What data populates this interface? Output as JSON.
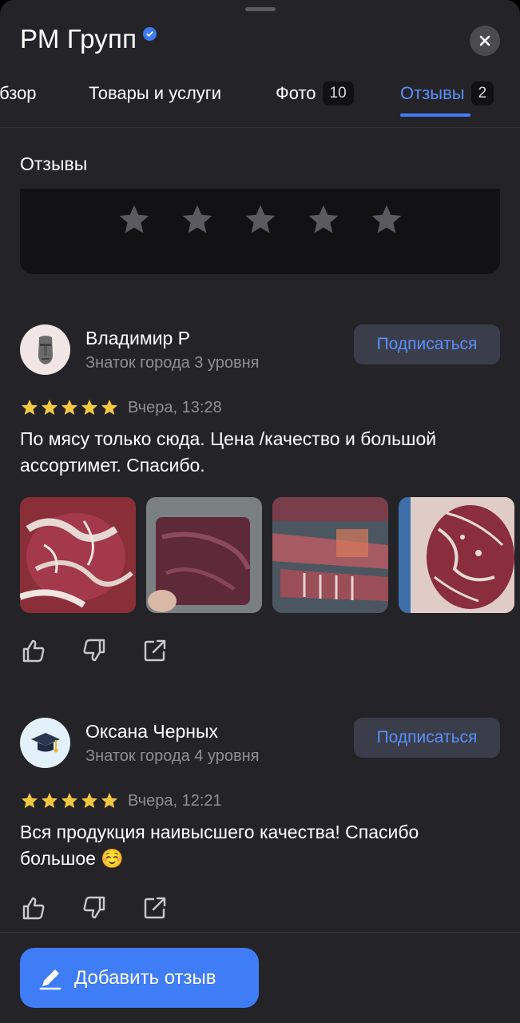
{
  "header": {
    "title": "РМ Групп",
    "verified_icon": "verified-check-icon",
    "close_icon": "close-icon"
  },
  "tabs": [
    {
      "label": "Обзор",
      "count": null,
      "active": false
    },
    {
      "label": "Товары и услуги",
      "count": null,
      "active": false
    },
    {
      "label": "Фото",
      "count": "10",
      "active": false
    },
    {
      "label": "Отзывы",
      "count": "2",
      "active": true
    }
  ],
  "reviews_section": {
    "title": "Отзывы",
    "rating_stars": 5
  },
  "reviews": [
    {
      "author": "Владимир Р",
      "level": "Знаток города 3 уровня",
      "subscribe_label": "Подписаться",
      "stars": 5,
      "date": "Вчера, 13:28",
      "text": "По мясу только сюда. Цена /качество и большой ассортимет. Спасибо.",
      "photo_count": 4,
      "avatar_icon": "moai-icon"
    },
    {
      "author": "Оксана Черных",
      "level": "Знаток города 4 уровня",
      "subscribe_label": "Подписаться",
      "stars": 5,
      "date": "Вчера, 12:21",
      "text": "Вся продукция наивысшего качества! Спасибо большое ☺️",
      "photo_count": 0,
      "avatar_icon": "graduation-cap-icon"
    }
  ],
  "footer": {
    "add_review_label": "Добавить отзыв",
    "add_review_icon": "pencil-icon"
  },
  "colors": {
    "background": "#242428",
    "accent": "#3e7df5",
    "link": "#5b8ff9",
    "star": "#f5c842"
  }
}
